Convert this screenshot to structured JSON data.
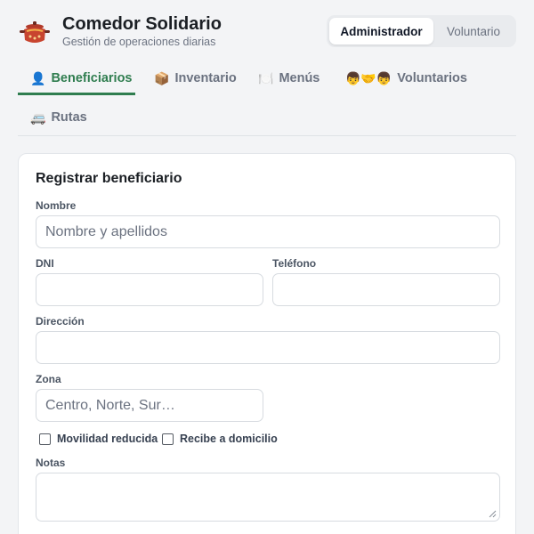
{
  "app": {
    "title": "Comedor Solidario",
    "subtitle": "Gestión de operaciones diarias",
    "logo_icon": "cooking-pot-icon"
  },
  "roles": {
    "active": "Administrador",
    "inactive": "Voluntario"
  },
  "tabs": [
    {
      "label": "Beneficiarios",
      "icon": "👤",
      "active": true
    },
    {
      "label": "Inventario",
      "icon": "📦",
      "active": false
    },
    {
      "label": "Menús",
      "icon": "🍽️",
      "active": false
    },
    {
      "label": "Voluntarios",
      "icon": "👦🤝👦",
      "active": false
    },
    {
      "label": "Rutas",
      "icon": "🚐",
      "active": false
    }
  ],
  "form": {
    "title": "Registrar beneficiario",
    "fields": {
      "nombre": {
        "label": "Nombre",
        "placeholder": "Nombre y apellidos",
        "value": ""
      },
      "dni": {
        "label": "DNI",
        "placeholder": "",
        "value": ""
      },
      "telefono": {
        "label": "Teléfono",
        "placeholder": "",
        "value": ""
      },
      "direccion": {
        "label": "Dirección",
        "placeholder": "",
        "value": ""
      },
      "zona": {
        "label": "Zona",
        "placeholder": "Centro, Norte, Sur…",
        "value": ""
      },
      "notas": {
        "label": "Notas",
        "placeholder": "",
        "value": ""
      }
    },
    "checkboxes": {
      "movilidad": {
        "label": "Movilidad reducida",
        "checked": false
      },
      "domicilio": {
        "label": "Recibe a domicilio",
        "checked": false
      }
    }
  },
  "colors": {
    "accent": "#2f7d4f",
    "background": "#f3f4f6",
    "muted_text": "#6b7280"
  }
}
